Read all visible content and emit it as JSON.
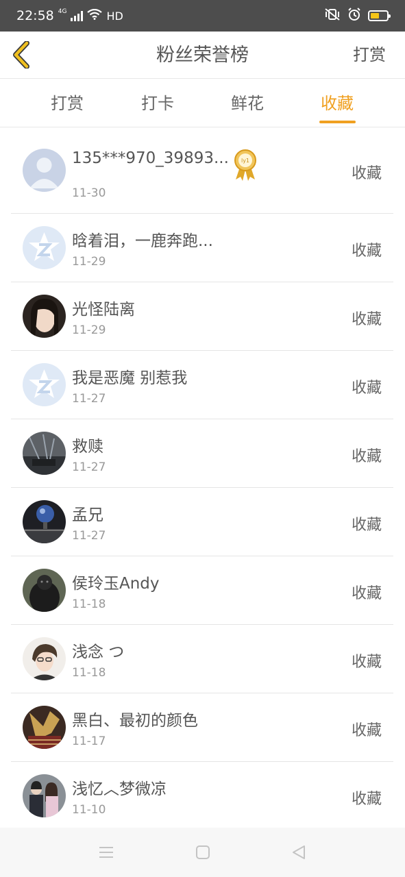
{
  "status_bar": {
    "time": "22:58",
    "network": "4G",
    "hd": "HD",
    "icons": [
      "signal-icon",
      "wifi-icon",
      "mute-vibrate-icon",
      "alarm-icon",
      "battery-icon"
    ],
    "battery_fill": 0.55,
    "battery_color": "#f5c518"
  },
  "header": {
    "title": "粉丝荣誉榜",
    "action": "打赏",
    "back_icon": "chevron-left-icon",
    "back_color": "#f0c020"
  },
  "tabs": [
    {
      "label": "打赏",
      "active": false
    },
    {
      "label": "打卡",
      "active": false
    },
    {
      "label": "鲜花",
      "active": false
    },
    {
      "label": "收藏",
      "active": true
    }
  ],
  "accent_color": "#f0a020",
  "list": [
    {
      "name": "135***970_39893...",
      "date": "11-30",
      "action": "收藏",
      "avatar": "default-person-avatar",
      "badge": "ly1"
    },
    {
      "name": "晗着泪，一鹿奔跑...",
      "date": "11-29",
      "action": "收藏",
      "avatar": "qzone-star-avatar"
    },
    {
      "name": "光怪陆离",
      "date": "11-29",
      "action": "收藏",
      "avatar": "photo-avatar"
    },
    {
      "name": "我是恶魔 别惹我",
      "date": "11-27",
      "action": "收藏",
      "avatar": "qzone-star-avatar"
    },
    {
      "name": "救赎",
      "date": "11-27",
      "action": "收藏",
      "avatar": "photo-avatar"
    },
    {
      "name": "孟兄",
      "date": "11-27",
      "action": "收藏",
      "avatar": "photo-avatar"
    },
    {
      "name": "侯玲玉Andy",
      "date": "11-18",
      "action": "收藏",
      "avatar": "photo-avatar"
    },
    {
      "name": "浅念 つ",
      "date": "11-18",
      "action": "收藏",
      "avatar": "photo-avatar"
    },
    {
      "name": "黑白、最初的颜色",
      "date": "11-17",
      "action": "收藏",
      "avatar": "photo-avatar"
    },
    {
      "name": "浅忆︿梦微凉",
      "date": "11-10",
      "action": "收藏",
      "avatar": "photo-avatar"
    }
  ],
  "nav_bar": {
    "icons": [
      "menu-icon",
      "home-square-icon",
      "back-triangle-icon"
    ]
  }
}
